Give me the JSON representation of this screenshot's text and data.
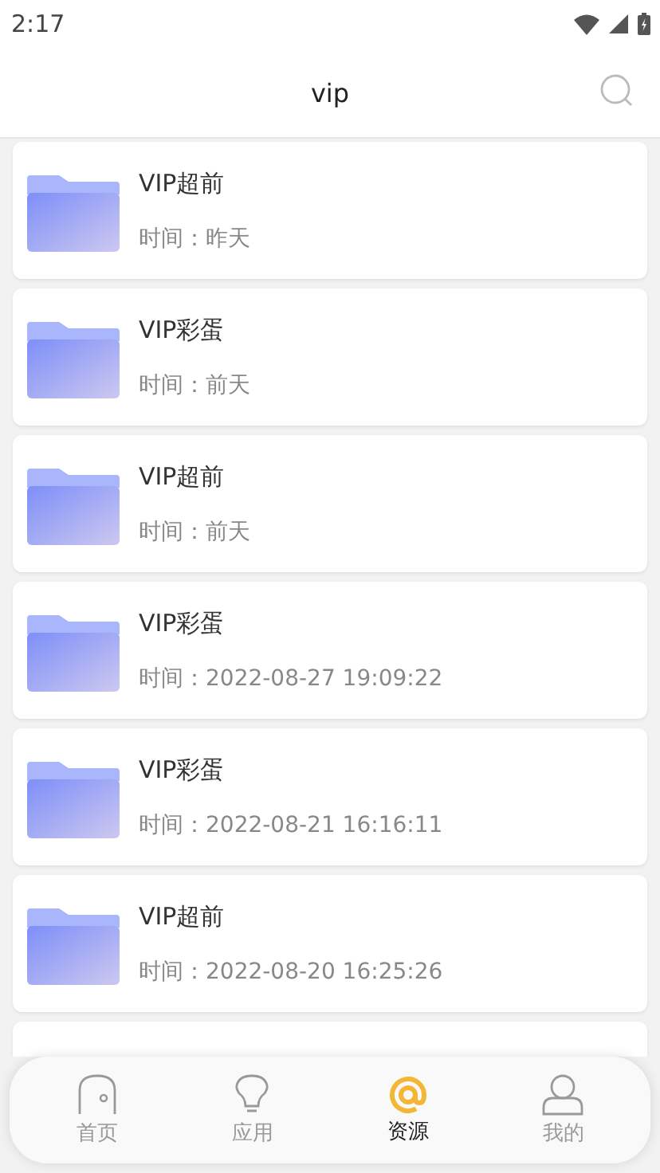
{
  "status_bar": {
    "time": "2:17"
  },
  "header": {
    "title": "vip"
  },
  "items": [
    {
      "title": "VIP超前",
      "time": "时间：昨天"
    },
    {
      "title": "VIP彩蛋",
      "time": "时间：前天"
    },
    {
      "title": "VIP超前",
      "time": "时间：前天"
    },
    {
      "title": "VIP彩蛋",
      "time": "时间：2022-08-27 19:09:22"
    },
    {
      "title": "VIP彩蛋",
      "time": "时间：2022-08-21 16:16:11"
    },
    {
      "title": "VIP超前",
      "time": "时间：2022-08-20 16:25:26"
    }
  ],
  "nav": [
    {
      "label": "首页",
      "selected": false
    },
    {
      "label": "应用",
      "selected": false
    },
    {
      "label": "资源",
      "selected": true
    },
    {
      "label": "我的",
      "selected": false
    }
  ]
}
